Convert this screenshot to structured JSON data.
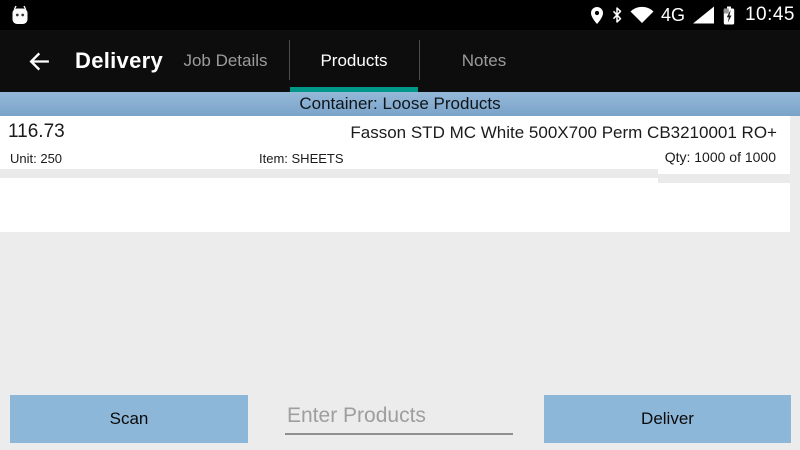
{
  "status_bar": {
    "time": "10:45",
    "network_label": "4G",
    "icons": {
      "android_head": "android-robot-head",
      "location": "location-pin",
      "bluetooth": "bluetooth",
      "wifi": "wifi-signal-full",
      "cell_signal": "cell-signal-full",
      "battery": "battery-charging"
    }
  },
  "header": {
    "title": "Delivery",
    "back_icon": "arrow-left",
    "tabs": [
      {
        "label": "Job Details",
        "active": false
      },
      {
        "label": "Products",
        "active": true
      },
      {
        "label": "Notes",
        "active": false
      }
    ]
  },
  "container_bar": {
    "label": "Container: Loose Products"
  },
  "product_row": {
    "price": "116.73",
    "name": "Fasson STD MC White 500X700 Perm CB3210001 RO+",
    "unit": "Unit: 250",
    "item": "Item: SHEETS",
    "qty": "Qty: 1000 of 1000"
  },
  "footer": {
    "scan_label": "Scan",
    "input_placeholder": "Enter Products",
    "input_value": "",
    "deliver_label": "Deliver"
  },
  "colors": {
    "status_bar_bg": "#000000",
    "action_bar_bg": "#0d0d0d",
    "active_tab_underline": "#009688",
    "container_bar_blue": "#84abce",
    "button_blue": "#8db7d9",
    "page_background": "#ececec",
    "card_background": "#ffffff",
    "inactive_tab_text": "#9b9b9b"
  }
}
